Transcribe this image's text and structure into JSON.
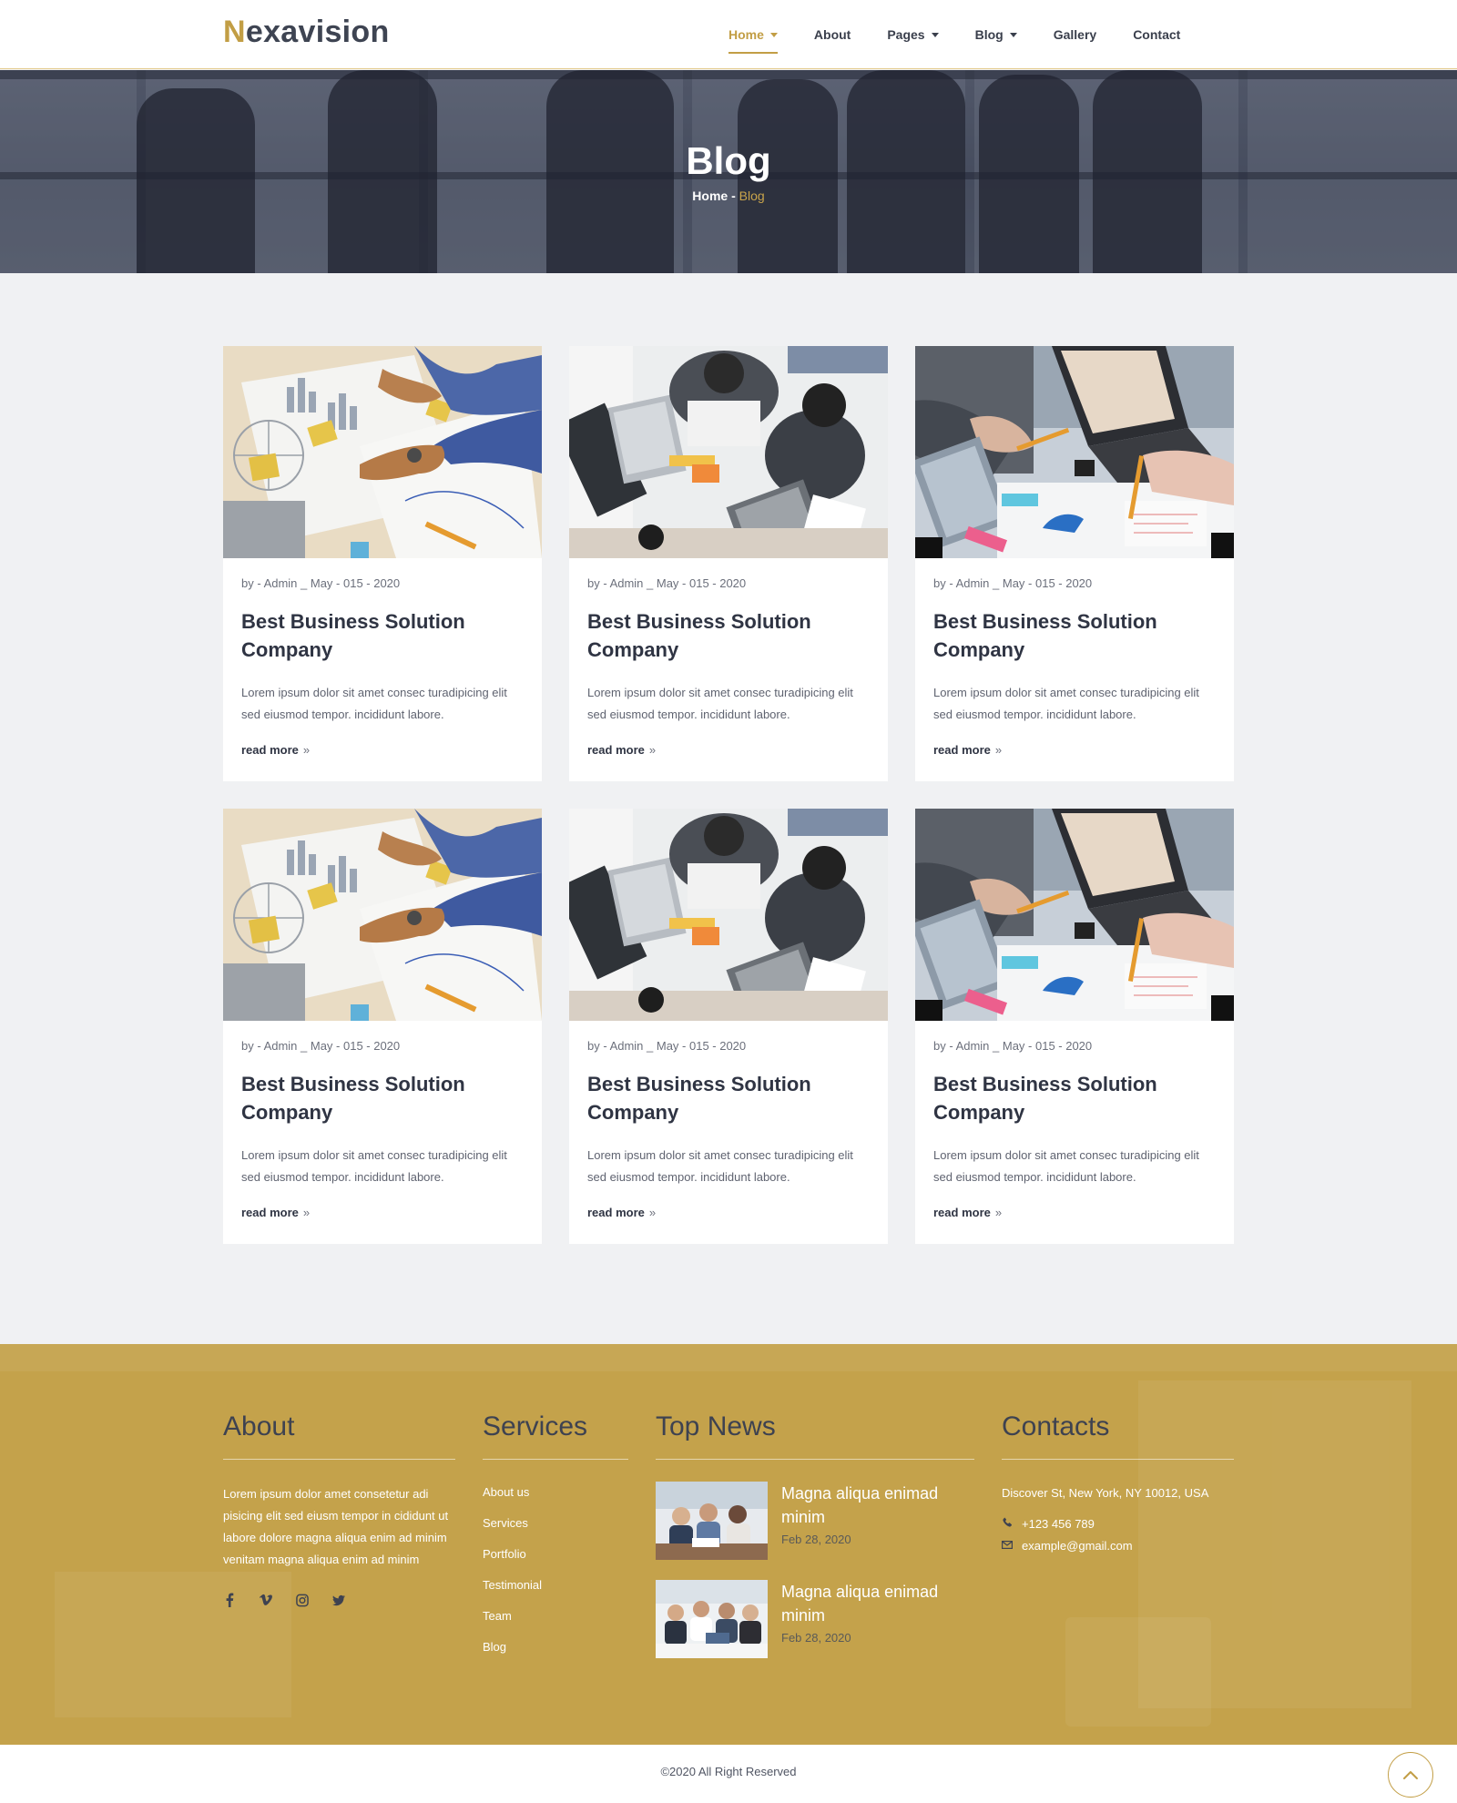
{
  "brand": {
    "first_letter": "N",
    "rest": "exavision",
    "accent_color": "#c29e45"
  },
  "nav": {
    "items": [
      {
        "label": "Home",
        "dropdown": true,
        "active": true
      },
      {
        "label": "About",
        "dropdown": false,
        "active": false
      },
      {
        "label": "Pages",
        "dropdown": true,
        "active": false
      },
      {
        "label": "Blog",
        "dropdown": true,
        "active": false
      },
      {
        "label": "Gallery",
        "dropdown": false,
        "active": false
      },
      {
        "label": "Contact",
        "dropdown": false,
        "active": false
      }
    ]
  },
  "hero": {
    "title": "Blog",
    "breadcrumb_home": "Home",
    "breadcrumb_separator": " - ",
    "breadcrumb_current": "Blog"
  },
  "posts": [
    {
      "image": "charts-desk",
      "meta": "by - Admin _ May - 015 - 2020",
      "title": "Best Business Solution Company",
      "excerpt": "Lorem ipsum dolor sit amet consec turadipicing elit sed eiusmod tempor. incididunt labore.",
      "link": "read more"
    },
    {
      "image": "team-laptops",
      "meta": "by - Admin _ May - 015 - 2020",
      "title": "Best Business Solution Company",
      "excerpt": "Lorem ipsum dolor sit amet consec turadipicing elit sed eiusmod tempor. incididunt labore.",
      "link": "read more"
    },
    {
      "image": "laptop-notes",
      "meta": "by - Admin _ May - 015 - 2020",
      "title": "Best Business Solution Company",
      "excerpt": "Lorem ipsum dolor sit amet consec turadipicing elit sed eiusmod tempor. incididunt labore.",
      "link": "read more"
    },
    {
      "image": "charts-desk",
      "meta": "by - Admin _ May - 015 - 2020",
      "title": "Best Business Solution Company",
      "excerpt": "Lorem ipsum dolor sit amet consec turadipicing elit sed eiusmod tempor. incididunt labore.",
      "link": "read more"
    },
    {
      "image": "team-laptops",
      "meta": "by - Admin _ May - 015 - 2020",
      "title": "Best Business Solution Company",
      "excerpt": "Lorem ipsum dolor sit amet consec turadipicing elit sed eiusmod tempor. incididunt labore.",
      "link": "read more"
    },
    {
      "image": "laptop-notes",
      "meta": "by - Admin _ May - 015 - 2020",
      "title": "Best Business Solution Company",
      "excerpt": "Lorem ipsum dolor sit amet consec turadipicing elit sed eiusmod tempor. incididunt labore.",
      "link": "read more"
    }
  ],
  "footer": {
    "about": {
      "heading": "About",
      "text": "Lorem ipsum dolor amet consetetur adi pisicing elit sed eiusm tempor in cididunt ut labore dolore magna aliqua enim ad minim venitam magna aliqua enim ad minim",
      "social": [
        "facebook-icon",
        "vimeo-icon",
        "instagram-icon",
        "twitter-icon"
      ]
    },
    "services": {
      "heading": "Services",
      "items": [
        "About us",
        "Services",
        "Portfolio",
        "Testimonial",
        "Team",
        "Blog"
      ]
    },
    "news": {
      "heading": "Top News",
      "items": [
        {
          "title": "Magna aliqua enimad minim",
          "date": "Feb 28, 2020"
        },
        {
          "title": "Magna aliqua enimad minim",
          "date": "Feb 28, 2020"
        }
      ]
    },
    "contacts": {
      "heading": "Contacts",
      "address": "Discover St, New York, NY 10012, USA",
      "phone": "+123 456 789",
      "email": "example@gmail.com"
    },
    "background_color": "#c4a24b"
  },
  "copyright": "©2020 All Right Reserved"
}
